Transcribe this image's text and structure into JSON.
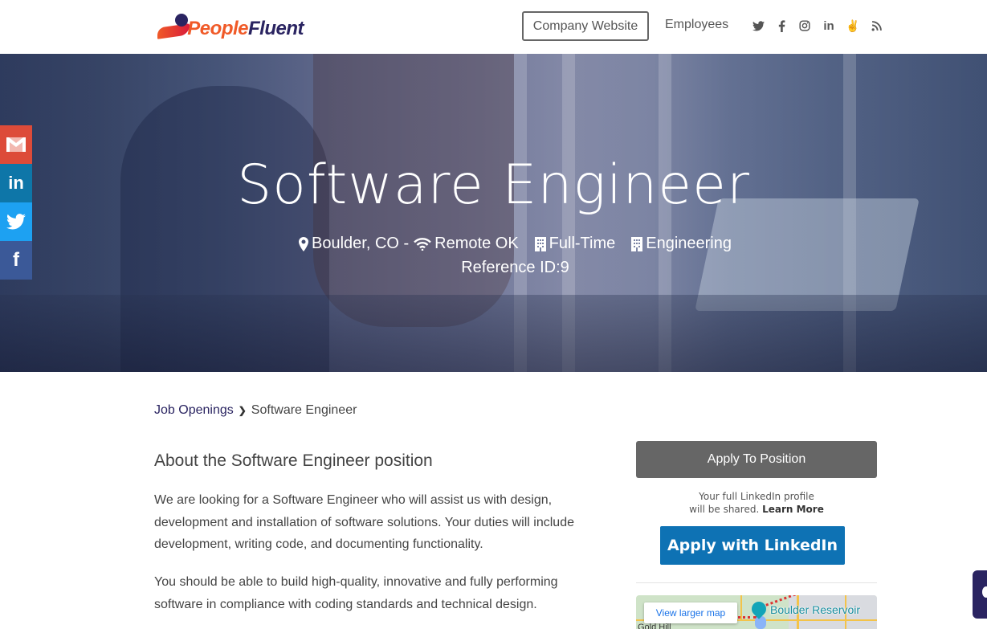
{
  "header": {
    "logo": {
      "part1": "People",
      "part2": "Fluent"
    },
    "nav": {
      "company_website": "Company Website",
      "employees": "Employees"
    },
    "social_icons": [
      "twitter-icon",
      "facebook-icon",
      "instagram-icon",
      "linkedin-icon",
      "angellist-icon",
      "rss-icon"
    ]
  },
  "share_bar": {
    "items": [
      "gmail",
      "linkedin",
      "twitter",
      "facebook"
    ]
  },
  "hero": {
    "title": "Software Engineer",
    "location": "Boulder, CO -",
    "remote": "Remote OK",
    "employment_type": "Full-Time",
    "department": "Engineering",
    "reference": "Reference ID:9"
  },
  "breadcrumb": {
    "parent": "Job Openings",
    "current": "Software Engineer"
  },
  "content": {
    "section_title": "About the Software Engineer position",
    "paragraphs": [
      "We are looking for a Software Engineer who will assist us with design, development and installation of software solutions. Your duties will include development, writing code, and documenting functionality.",
      "You should be able to build high-quality, innovative and fully performing software in compliance with coding standards and technical design."
    ]
  },
  "sidebar": {
    "apply_button": "Apply To Position",
    "linkedin_note_line1": "Your full LinkedIn profile",
    "linkedin_note_line2": "will be shared.",
    "learn_more": "Learn More",
    "linkedin_button": "Apply with LinkedIn",
    "map": {
      "view_larger": "View larger map",
      "place_label": "Boulder Reservoir",
      "partial_label": "Gold Hill"
    }
  },
  "colors": {
    "brand_navy": "#2a2461",
    "brand_orange": "#f05a28",
    "apply_gray": "#666666",
    "linkedin_blue": "#0e72b4",
    "gmail_red": "#dd4b39",
    "twitter_blue": "#1da1f2",
    "facebook_blue": "#3b5998"
  }
}
